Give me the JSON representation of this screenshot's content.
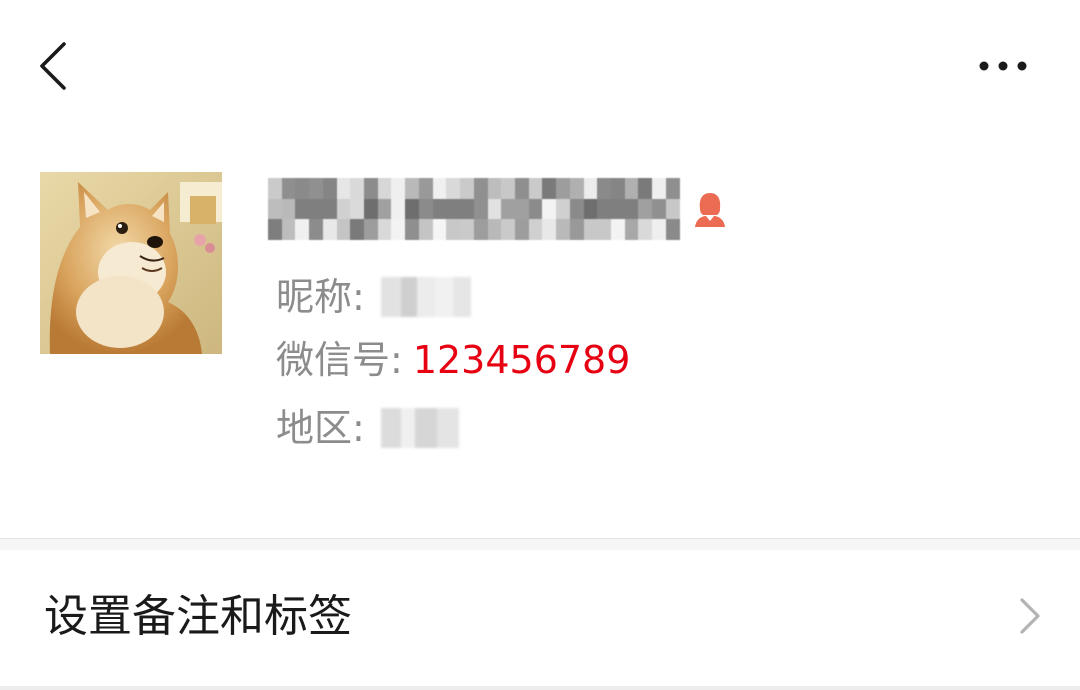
{
  "header": {
    "back_icon": "chevron-left-icon",
    "more_icon": "more-dots-icon"
  },
  "profile": {
    "avatar_icon": "avatar-image",
    "gender_icon": "female-icon",
    "gender_color": "#ec6b53",
    "nickname_label": "昵称:",
    "wechat_id_label": "微信号:",
    "wechat_id_value": "123456789",
    "wechat_id_color": "#e60012",
    "region_label": "地区:"
  },
  "settings": {
    "remark_label": "设置备注和标签",
    "chevron_icon": "chevron-right-icon"
  }
}
